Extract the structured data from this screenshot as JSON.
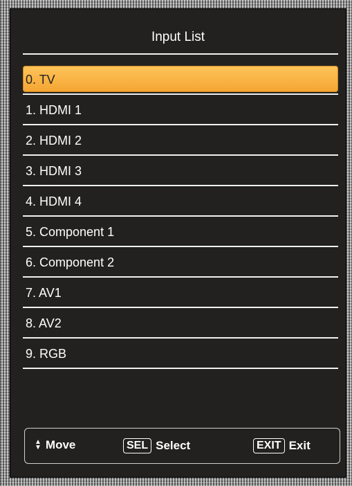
{
  "window": {
    "title": "Input List"
  },
  "inputs": [
    {
      "label": "0. TV",
      "selected": true
    },
    {
      "label": "1. HDMI 1"
    },
    {
      "label": "2. HDMI 2"
    },
    {
      "label": "3. HDMI 3"
    },
    {
      "label": "4. HDMI 4"
    },
    {
      "label": "5. Component 1"
    },
    {
      "label": "6. Component 2"
    },
    {
      "label": "7. AV1"
    },
    {
      "label": "8. AV2"
    },
    {
      "label": "9. RGB"
    }
  ],
  "footer": {
    "move_icon": "up-down-arrows-icon",
    "move_label": "Move",
    "select_key": "SEL",
    "select_label": "Select",
    "exit_key": "EXIT",
    "exit_label": "Exit"
  },
  "colors": {
    "panel_bg": "#222120",
    "highlight": "#f4a532",
    "text": "#ffffff"
  }
}
